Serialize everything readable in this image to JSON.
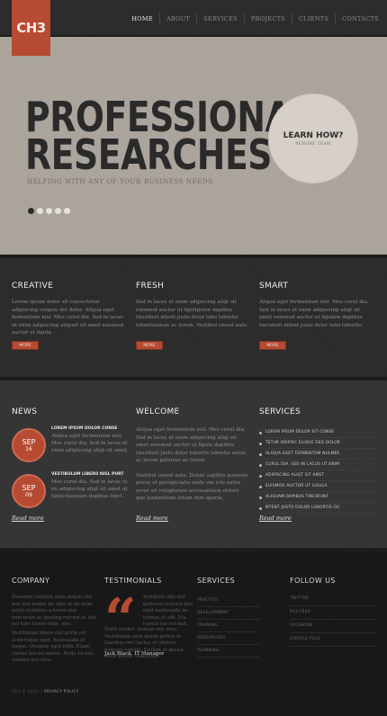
{
  "header": {
    "logo": "CH3",
    "nav": [
      {
        "label": "HOME",
        "active": true
      },
      {
        "label": "ABOUT",
        "active": false
      },
      {
        "label": "SERVICES",
        "active": false
      },
      {
        "label": "PROJECTS",
        "active": false
      },
      {
        "label": "CLIENTS",
        "active": false
      },
      {
        "label": "CONTACTS",
        "active": false
      }
    ]
  },
  "hero": {
    "title_line1": "PROFESSIONAL",
    "title_line2": "RESEARCHES",
    "tagline": "HELPING WITH ANY OF YOUR BUSINESS NEEDS",
    "cta_title": "LEARN HOW?",
    "cta_sub": "BENOBE TEAM",
    "slides": 5,
    "active_slide": 1
  },
  "features": [
    {
      "title": "CREATIVE",
      "text": "Lorem ipsum dolor sit consectetur adipiscing congue dol dolor. Aliqua eget fermentum nisl. Mes curul dia. Sed in lacus ut enim adipiscing aliquet sit amet euismod auctor ut ligula.",
      "button": "MORE"
    },
    {
      "title": "FRESH",
      "text": "Sed in lacus ut enim adipiscing aliqt sit euismod auctor ut ligulipsum dapibus tincidunt mtent justo dolor lobo lobortis lobortisamue ac lorem. Vestibul unsed aute.",
      "button": "MORE"
    },
    {
      "title": "SMART",
      "text": "Aliqua eget fermentum nisl. Mes curul dia. Sed in lacus ut enim adipiscing aliqt sit amet euismod auctor ut ligulam dapibus tincidunt mtent justo dolor lobo lobortis.",
      "button": "MORE"
    }
  ],
  "news": {
    "title": "NEWS",
    "items": [
      {
        "month": "SEP",
        "day": "16",
        "headline": "LOREM IPSUM DOLOR CONSE",
        "text": "Aliqua eget fermentum nisl. Mes curul dia. Sed in lacus ut enim adipiscing aliqt sit amet."
      },
      {
        "month": "SEP",
        "day": "09",
        "headline": "VESTIBULUM LIBERO NISL PORT",
        "text": "Mes curul dia. Sed in lacus ut en adipiscing aliqt sit amet ut ligulcilisquam dapibus tinct."
      }
    ],
    "link": "Read more"
  },
  "welcome": {
    "title": "WELCOME",
    "paragraphs": [
      "Aliqua eget fermentum nisl. Mes curul dia. Sed in lacus ut enim adipiscing aliqt sit amet euismod auctor ut ligula dapibus tincidunt justo dolor lobortis lobortis amue ac lorem pulvinar ac lorem.",
      "Vestibul unsed aute. Donec sagittis posuere purus ut persipiciatis unde om iste natus error sit voluptatem accusantium dolore que laudantium totam rem aperia."
    ],
    "link": "Read more"
  },
  "services": {
    "title": "SERVICES",
    "items": [
      "LOREM IPSUM DOLOR SIT CONSE",
      "TETUR ADIPISC ELIQUE DEQ DOLOR",
      "ALIQUA EGET FERMENTUM NULMEE",
      "CURUL DIA. SED IN LACUS UT ENIM",
      "ADIPISCING ALIQT SIT AMET",
      "EUISMOD AUCTOR UT LIGULA",
      "ALIQUAM DAPIBUS TINCIDUNT",
      "MTENT JUSTO DOLOR LOBORTIS OU"
    ],
    "link": "Read more"
  },
  "footer": {
    "company": {
      "title": "COMPANY",
      "text1": "Praesent vestibul edna pequis ete non nisi neque mi eget ut ob nolm nolet vivisimus a lorem nisi noncerum ac posting rutrum ac fini nel tuer lorem enim, nisi.",
      "text2": "Vestibulum libero nisl porta vel scelerisque eget, malesuada at neque. Vivamus eget nibh. Etiam cursus leo vel metus. Nulla facilisi. Aenean nec eros."
    },
    "testimonials": {
      "title": "TESTIMONIALS",
      "text1": "Vestibulu libe nisl portavel sceleris que eget malesuada ne ruimas ut nib. Eta cursus leo vel met.",
      "text2": "Nulla facilisi. Aenean nec eros. Vestibulum ante ipsum primis in faucibus orci luctus et ultrices posuere cubilia. Nullam et massa dolor lorem. Maecenas.",
      "author": "Jack Black, IT Manager"
    },
    "services": {
      "title": "SERVICES",
      "items": [
        "PRACTICE",
        "DEVELOPMENT",
        "TRAINING",
        "RESEARCHES",
        "PLANNING"
      ]
    },
    "follow": {
      "title": "FOLLOW  US",
      "items": [
        "TWITTER",
        "RSS FEED",
        "FACEBOOK",
        "GOOGLE PLUS"
      ]
    },
    "copyright": "CH3 © 2013 •",
    "policy": "PRIVACY POLICY"
  },
  "colors": {
    "accent": "#b64a32",
    "hero_bg": "#aca59d",
    "dark_bg": "#2b2b2b",
    "footer_bg": "#171717"
  }
}
